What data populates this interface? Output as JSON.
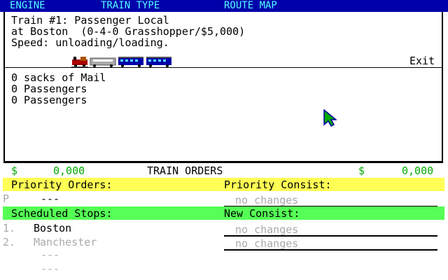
{
  "menu": {
    "items": [
      {
        "label": "ENGINE"
      },
      {
        "label": "TRAIN TYPE"
      },
      {
        "label": "ROUTE MAP"
      }
    ]
  },
  "train_info": {
    "line1": "Train #1: Passenger Local",
    "line2": "at Boston  (0-4-0 Grasshopper/$5,000)",
    "line3": "Speed: unloading/loading.",
    "exit_label": "Exit"
  },
  "cargo": [
    "0 sacks of Mail",
    "0 Passengers",
    "0 Passengers"
  ],
  "money_left": {
    "symbol": "$",
    "value": "0,000"
  },
  "money_right": {
    "symbol": "$",
    "value": "0,000"
  },
  "section_title": "TRAIN ORDERS",
  "priority_orders": {
    "header": "Priority Orders:",
    "marker": "P",
    "value": "---"
  },
  "priority_consist": {
    "header": "Priority Consist:",
    "value": "no changes"
  },
  "scheduled_stops": {
    "header": "Scheduled Stops:",
    "stops": [
      {
        "num": "1.",
        "name": "Boston"
      },
      {
        "num": "2.",
        "name": "Manchester"
      },
      {
        "num": "",
        "name": "---"
      },
      {
        "num": "",
        "name": "---"
      }
    ]
  },
  "new_consist": {
    "header": "New Consist:",
    "values": [
      "no changes",
      "no changes"
    ]
  },
  "colors": {
    "menu_bg": "#0000aa",
    "menu_text": "#55ffff",
    "yellow": "#ffff55",
    "green": "#55ff55",
    "money": "#00aa00",
    "gray": "#aaaaaa"
  }
}
